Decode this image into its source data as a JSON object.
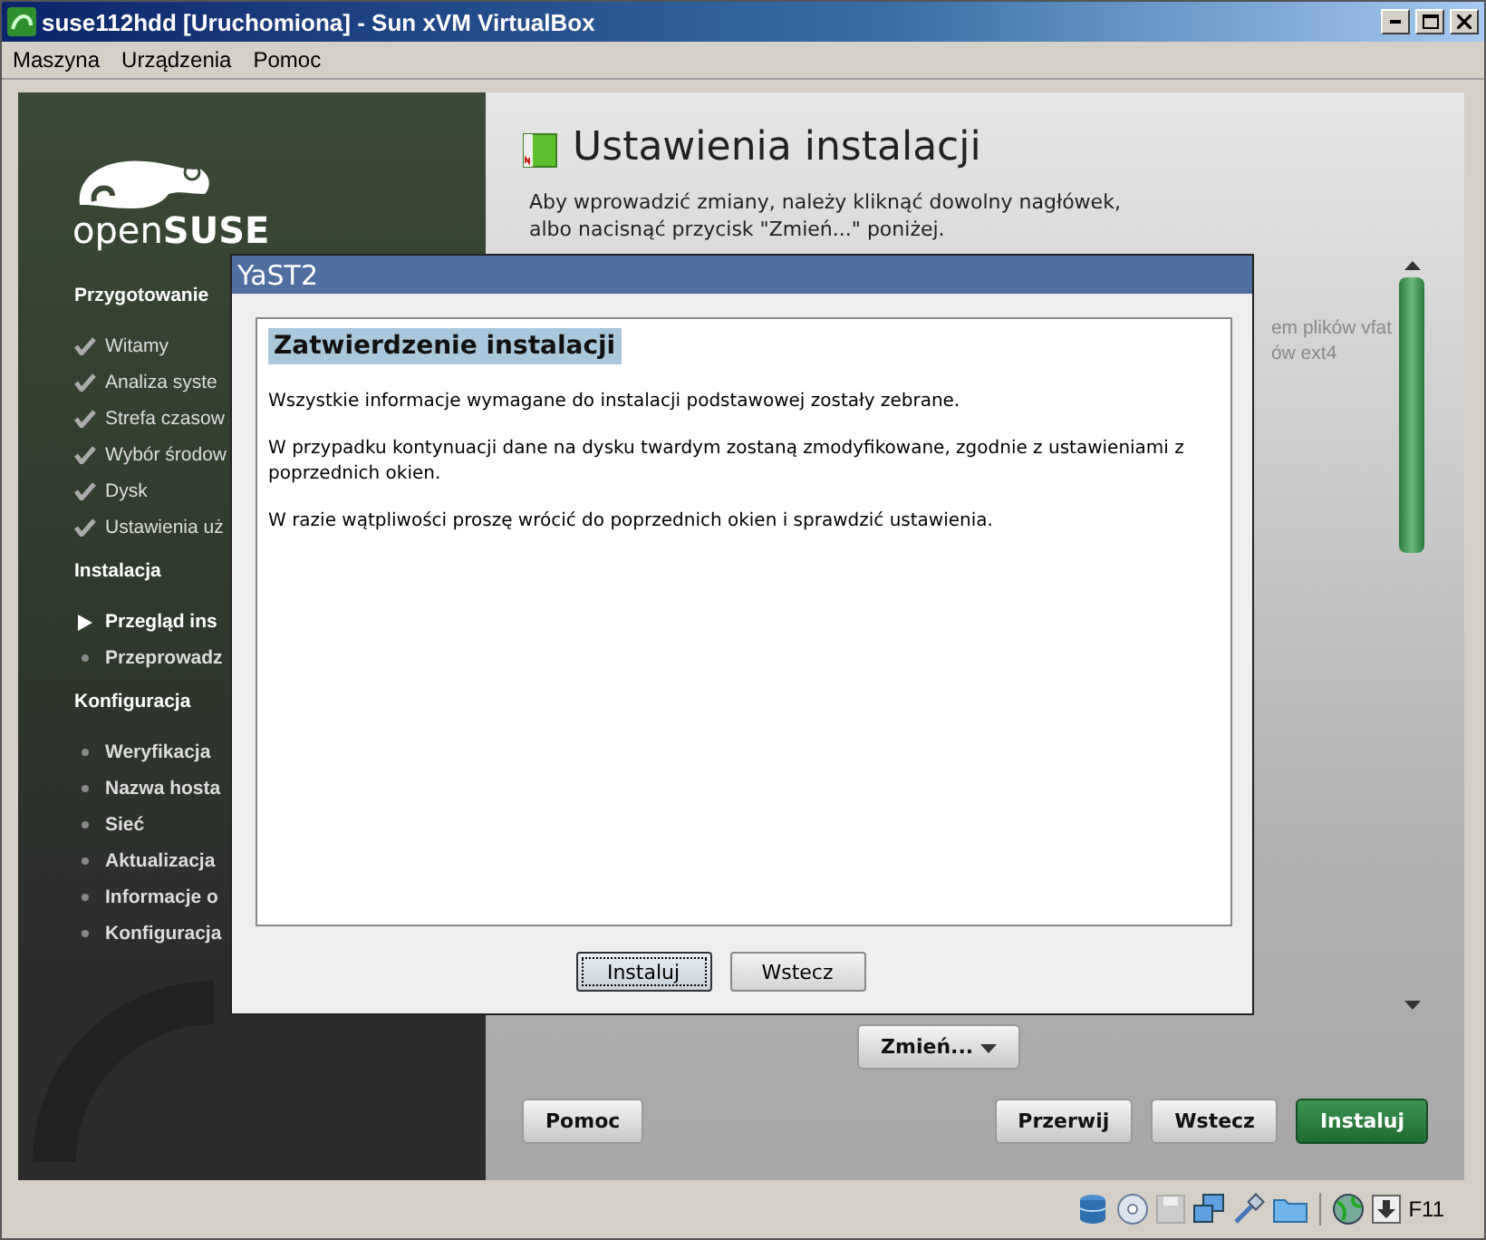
{
  "window": {
    "title": "suse112hdd [Uruchomiona] - Sun xVM VirtualBox"
  },
  "menu": [
    "Maszyna",
    "Urządzenia",
    "Pomoc"
  ],
  "sidebar": {
    "logo": "open**SUSE**",
    "sections": [
      {
        "title": "Przygotowanie",
        "items": [
          {
            "label": "Witamy",
            "kind": "done"
          },
          {
            "label": "Analiza syste",
            "kind": "done"
          },
          {
            "label": "Strefa czasow",
            "kind": "done"
          },
          {
            "label": "Wybór środow",
            "kind": "done"
          },
          {
            "label": "Dysk",
            "kind": "done"
          },
          {
            "label": "Ustawienia uż",
            "kind": "done"
          }
        ]
      },
      {
        "title": "Instalacja",
        "items": [
          {
            "label": "Przegląd ins",
            "kind": "current"
          },
          {
            "label": "Przeprowadz",
            "kind": "pending"
          }
        ]
      },
      {
        "title": "Konfiguracja",
        "items": [
          {
            "label": "Weryfikacja",
            "kind": "pending"
          },
          {
            "label": "Nazwa hosta",
            "kind": "pending"
          },
          {
            "label": "Sieć",
            "kind": "pending"
          },
          {
            "label": "Aktualizacja",
            "kind": "pending"
          },
          {
            "label": "Informacje o",
            "kind": "pending"
          },
          {
            "label": "Konfiguracja",
            "kind": "pending"
          }
        ]
      }
    ]
  },
  "main": {
    "title": "Ustawienia instalacji",
    "description": [
      "Aby wprowadzić zmiany, należy kliknąć dowolny nagłówek,",
      "albo nacisnąć przycisk \"Zmień...\" poniżej."
    ],
    "hidden_lines": [
      "em plików vfat",
      "ów ext4"
    ],
    "change_button": "Zmień...",
    "buttons": [
      {
        "label": "Pomoc",
        "kind": "normal"
      },
      {
        "label": "Przerwij",
        "kind": "normal"
      },
      {
        "label": "Wstecz",
        "kind": "normal"
      },
      {
        "label": "Instaluj",
        "kind": "primary"
      }
    ]
  },
  "dialog": {
    "title": "YaST2",
    "heading": "Zatwierdzenie instalacji",
    "paragraphs": [
      "Wszystkie informacje wymagane do instalacji podstawowej zostały zebrane.",
      "W przypadku kontynuacji dane na dysku twardym zostaną zmodyfikowane, zgodnie z ustawieniami z poprzednich okien.",
      "W razie wątpliwości proszę wrócić do poprzednich okien i sprawdzić ustawienia."
    ],
    "buttons": [
      {
        "label": "Instaluj",
        "focused": true
      },
      {
        "label": "Wstecz",
        "focused": false
      }
    ]
  },
  "status_bar": {
    "host_key": "F11"
  }
}
